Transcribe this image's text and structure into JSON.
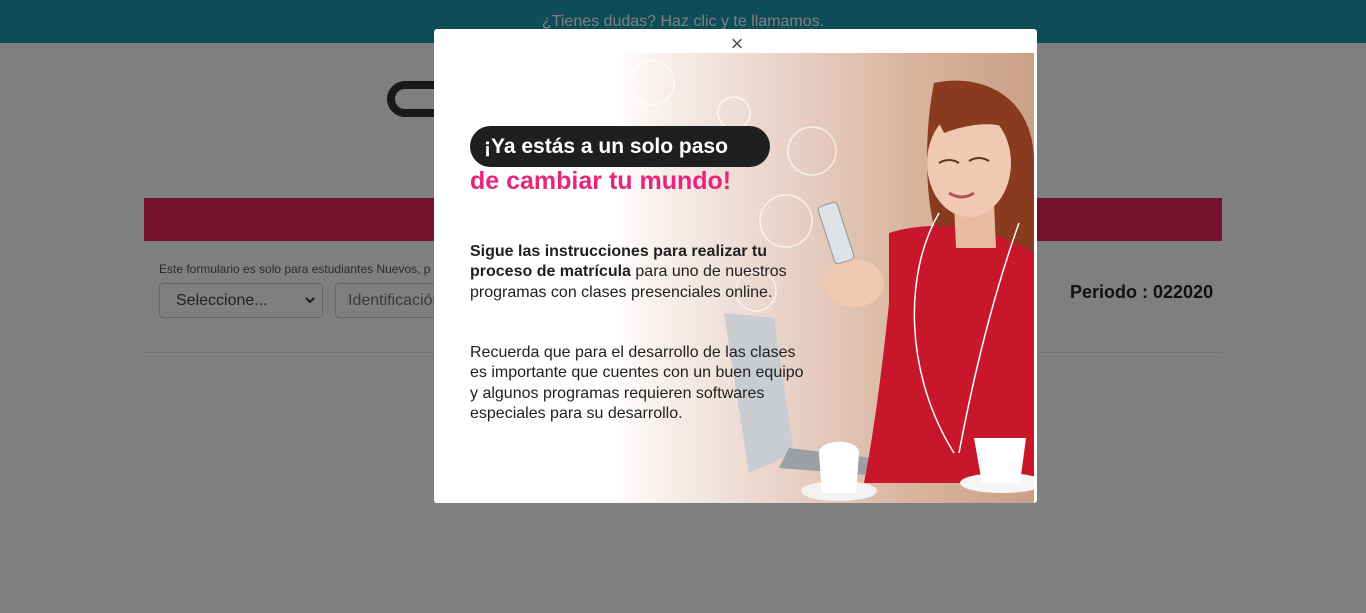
{
  "topbar": {
    "callback_text": "¿Tienes dudas? Haz clic y te llamamos."
  },
  "form": {
    "note": "Este formulario es solo para estudiantes Nuevos, p",
    "select_value": "Seleccione...",
    "id_placeholder": "Identificación",
    "periodo_label": "Periodo :",
    "periodo_value": "022020"
  },
  "modal": {
    "close_label": "×",
    "promo": {
      "headline_1": "¡Ya estás a un solo paso",
      "headline_2": "de cambiar tu mundo!",
      "para1_bold": "Sigue las instrucciones para realizar tu proceso de matrícula",
      "para1_rest": " para uno de nuestros programas con clases presenciales online.",
      "para2": "Recuerda que para el desarrollo de las clases es importante que cuentes con un buen equipo y algunos programas requieren softwares especiales para su desarrollo."
    }
  },
  "colors": {
    "topbar": "#1d9bb0",
    "accent_pink": "#e8245f",
    "headline_pink": "#e8247c",
    "pill_dark": "#1f1f1f"
  },
  "icons": {
    "close": "close-icon",
    "select_chevron": "chevron-down-icon",
    "logo": "logo-icon"
  }
}
